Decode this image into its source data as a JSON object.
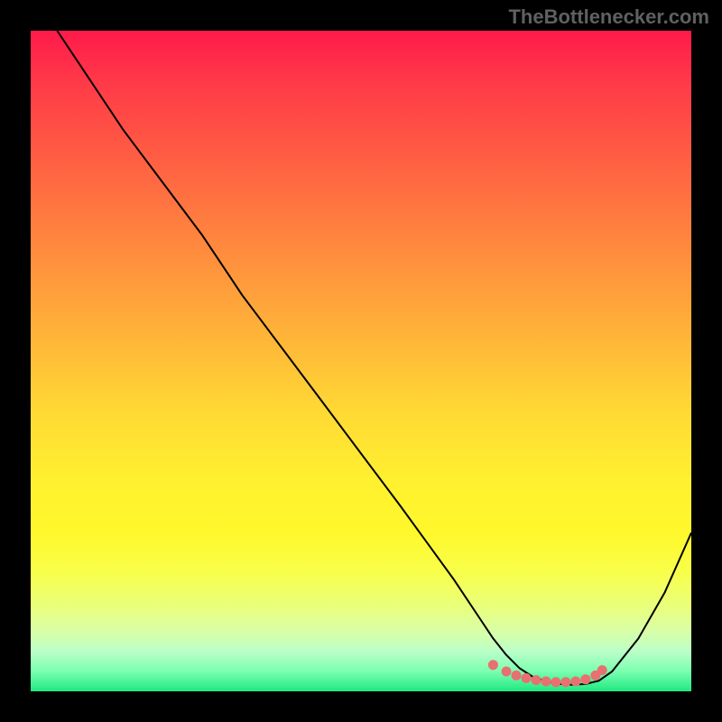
{
  "attribution": "TheBottlenecker.com",
  "chart_data": {
    "type": "line",
    "title": "",
    "xlabel": "",
    "ylabel": "",
    "xlim": [
      0,
      100
    ],
    "ylim": [
      0,
      100
    ],
    "series": [
      {
        "name": "curve",
        "x": [
          4,
          8,
          14,
          20,
          26,
          32,
          38,
          44,
          50,
          56,
          60,
          64,
          68,
          70,
          72,
          74,
          76,
          78,
          80,
          82,
          84,
          86,
          88,
          92,
          96,
          100
        ],
        "values": [
          100,
          94,
          85,
          77,
          69,
          60,
          52,
          44,
          36,
          28,
          22.5,
          17,
          11,
          8,
          5.5,
          3.5,
          2.2,
          1.5,
          1.1,
          1.0,
          1.1,
          1.6,
          3,
          8,
          15,
          24
        ]
      },
      {
        "name": "dots",
        "x": [
          70,
          72,
          73.5,
          75,
          76.5,
          78,
          79.5,
          81,
          82.5,
          84,
          85.5,
          86.5
        ],
        "values": [
          4.0,
          3.0,
          2.4,
          2.0,
          1.7,
          1.5,
          1.4,
          1.4,
          1.5,
          1.8,
          2.4,
          3.2
        ]
      }
    ]
  }
}
